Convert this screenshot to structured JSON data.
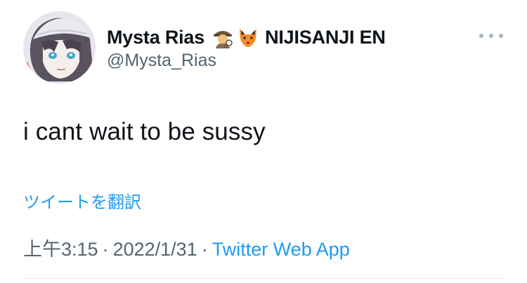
{
  "tweet": {
    "display_name": "Mysta Rias",
    "display_name_emojis": [
      "detective-emoji",
      "fox-emoji"
    ],
    "display_name_suffix": "NIJISANJI EN",
    "handle": "@Mysta_Rias",
    "text": "i cant wait to be sussy",
    "translate_label": "ツイートを翻訳",
    "time": "上午3:15",
    "separator": "·",
    "date": "2022/1/31",
    "source": "Twitter Web App",
    "more_icon": "more-horizontal-icon"
  },
  "colors": {
    "text": "#0f1419",
    "secondary": "#536471",
    "link": "#1d9bf0",
    "more_dots": "#aab8c2",
    "divider": "#e6e9ec"
  }
}
